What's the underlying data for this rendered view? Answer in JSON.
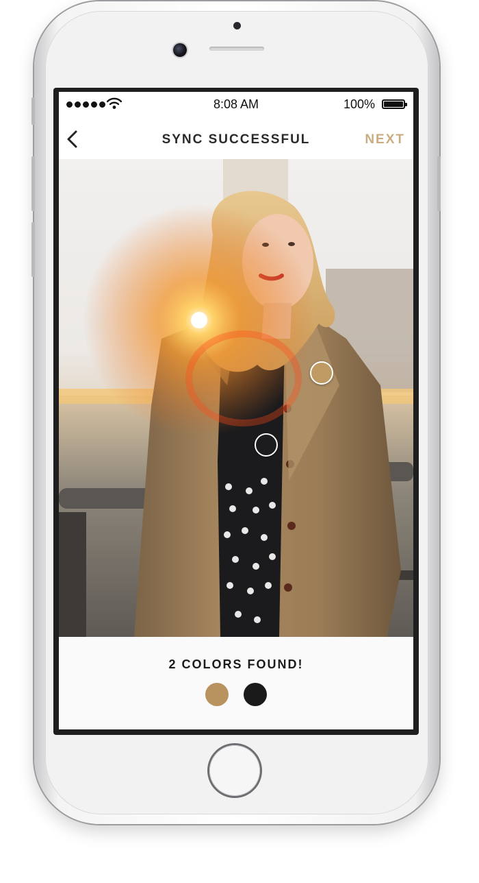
{
  "status_bar": {
    "time": "8:08 AM",
    "battery_percent": "100%",
    "battery_level": 1.0,
    "signal_dots": 5
  },
  "nav": {
    "back_icon": "chevron-left-icon",
    "title": "SYNC SUCCESSFUL",
    "next_label": "NEXT"
  },
  "photo": {
    "markers": [
      {
        "color": "#bf9b63"
      },
      {
        "color": "#1c1c1e"
      }
    ]
  },
  "results": {
    "title": "2 COLORS FOUND!",
    "swatches": [
      {
        "color": "#b8935f"
      },
      {
        "color": "#1a1a1a"
      }
    ]
  },
  "colors": {
    "accent": "#c9ad80",
    "text": "#2a2a2a"
  }
}
